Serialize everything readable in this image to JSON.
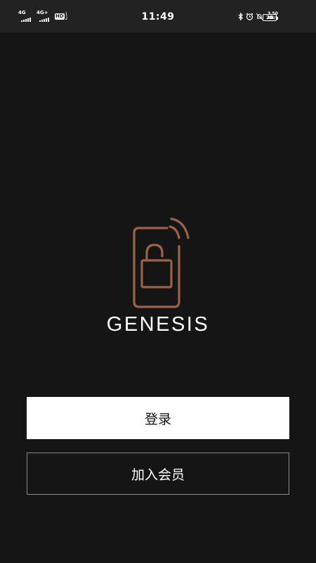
{
  "status_bar": {
    "network_1": "4G",
    "network_2": "4G+",
    "hd": "HD",
    "sim_1": "1",
    "sim_2": "2",
    "time": "11:49",
    "speed_value": "3.50",
    "speed_unit": "KB/s",
    "battery": "26",
    "icons": [
      "bluetooth-icon",
      "alarm-icon",
      "mute-icon",
      "battery-icon"
    ]
  },
  "logo": {
    "icon": "phone-lock-wireless-icon",
    "brand": "GENESIS",
    "accent_color": "#9c6248"
  },
  "actions": {
    "login_label": "登录",
    "join_label": "加入会员"
  }
}
